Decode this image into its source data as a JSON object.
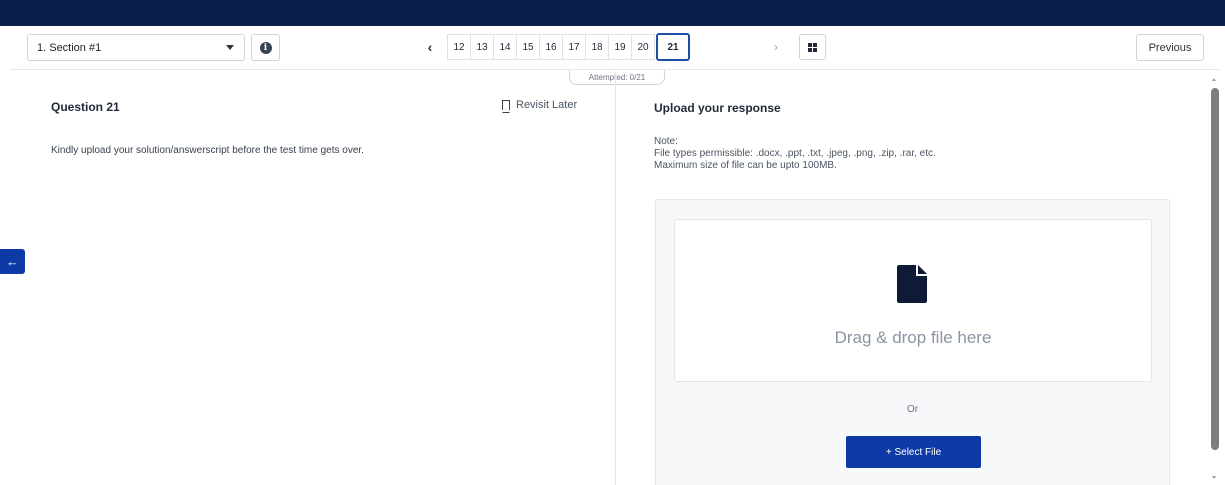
{
  "header": {
    "section_label": "1. Section #1",
    "question_numbers": [
      "12",
      "13",
      "14",
      "15",
      "16",
      "17",
      "18",
      "19",
      "20",
      "21"
    ],
    "active_question": "21",
    "previous_label": "Previous",
    "attempted": "Attempted: 0/21"
  },
  "question": {
    "title": "Question 21",
    "revisit_label": "Revisit Later",
    "text": "Kindly upload your solution/answerscript before the test time gets over."
  },
  "upload": {
    "title": "Upload your response",
    "note_label": "Note:",
    "file_types": "File types permissible: .docx, .ppt, .txt, .jpeg, .png, .zip, .rar, etc.",
    "max_size": "Maximum size of file can be upto 100MB.",
    "drop_text": "Drag & drop file here",
    "or_text": "Or",
    "select_label": "+ Select File"
  },
  "colors": {
    "topbar": "#0b1f4d",
    "accent": "#0d3aa6",
    "active_border": "#1e4fa8"
  },
  "icons": {
    "info": "info-icon",
    "grid": "grid-icon",
    "bookmark": "bookmark-icon",
    "file": "file-icon",
    "back": "arrow-left-icon"
  }
}
